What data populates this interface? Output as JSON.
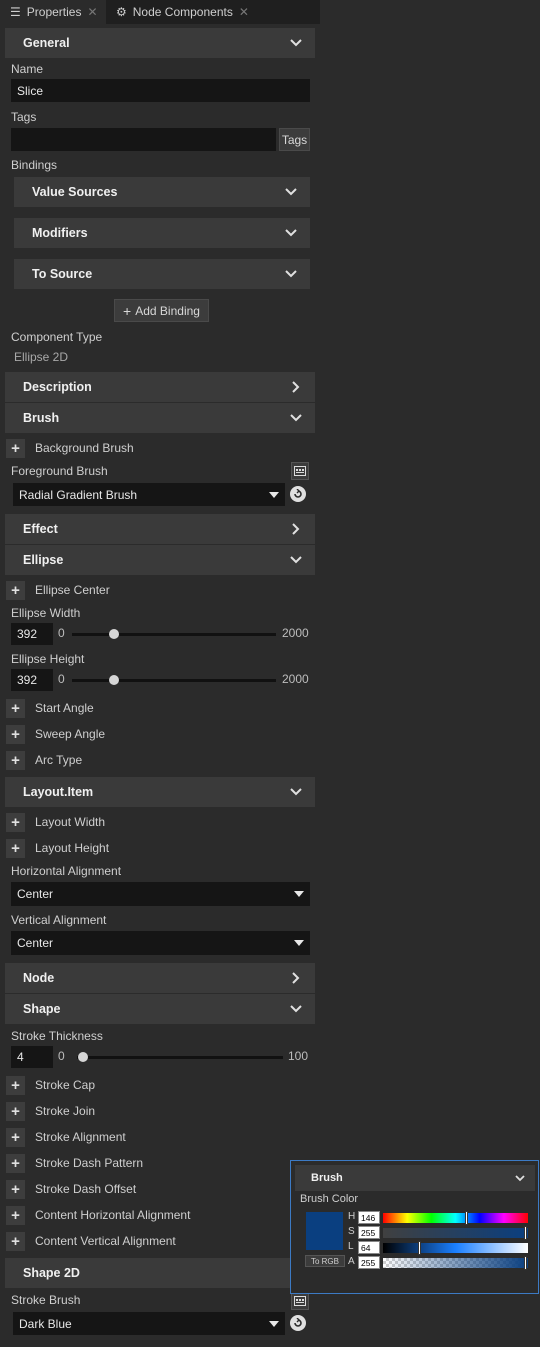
{
  "tabs": [
    {
      "label": "Properties",
      "icon": "list-icon",
      "active": true
    },
    {
      "label": "Node Components",
      "icon": "node-components-icon",
      "active": false
    }
  ],
  "general": {
    "header": "General",
    "name_label": "Name",
    "name_value": "Slice",
    "tags_label": "Tags",
    "tags_value": "",
    "tags_button": "Tags",
    "bindings_label": "Bindings",
    "value_sources": "Value Sources",
    "modifiers": "Modifiers",
    "to_source": "To Source",
    "add_binding": "Add Binding",
    "component_type_label": "Component Type",
    "component_type_value": "Ellipse 2D"
  },
  "description": {
    "header": "Description"
  },
  "brush": {
    "header": "Brush",
    "background_brush": "Background Brush",
    "foreground_label": "Foreground Brush",
    "foreground_value": "Radial Gradient Brush"
  },
  "effect": {
    "header": "Effect"
  },
  "ellipse": {
    "header": "Ellipse",
    "center": "Ellipse Center",
    "width_label": "Ellipse Width",
    "width_value": "392",
    "width_min": "0",
    "width_max": "2000",
    "height_label": "Ellipse Height",
    "height_value": "392",
    "height_min": "0",
    "height_max": "2000",
    "start_angle": "Start Angle",
    "sweep_angle": "Sweep Angle",
    "arc_type": "Arc Type"
  },
  "layout_item": {
    "header": "Layout.Item",
    "layout_width": "Layout Width",
    "layout_height": "Layout Height",
    "h_align_label": "Horizontal Alignment",
    "h_align_value": "Center",
    "v_align_label": "Vertical Alignment",
    "v_align_value": "Center"
  },
  "node": {
    "header": "Node"
  },
  "shape": {
    "header": "Shape",
    "stroke_thickness_label": "Stroke Thickness",
    "stroke_thickness_value": "4",
    "stroke_min": "0",
    "stroke_max": "100",
    "stroke_cap": "Stroke Cap",
    "stroke_join": "Stroke Join",
    "stroke_alignment": "Stroke Alignment",
    "stroke_dash_pattern": "Stroke Dash Pattern",
    "stroke_dash_offset": "Stroke Dash Offset",
    "content_h_align": "Content Horizontal Alignment",
    "content_v_align": "Content Vertical Alignment"
  },
  "shape2d": {
    "header": "Shape 2D",
    "stroke_brush_label": "Stroke Brush",
    "stroke_brush_value": "Dark Blue"
  },
  "brush_popup": {
    "header": "Brush",
    "color_label": "Brush Color",
    "to_rgb": "To RGB",
    "swatch_color": "#0a3f80",
    "channels": [
      {
        "name": "H",
        "value": "146"
      },
      {
        "name": "S",
        "value": "255"
      },
      {
        "name": "L",
        "value": "64"
      },
      {
        "name": "A",
        "value": "255"
      }
    ]
  }
}
